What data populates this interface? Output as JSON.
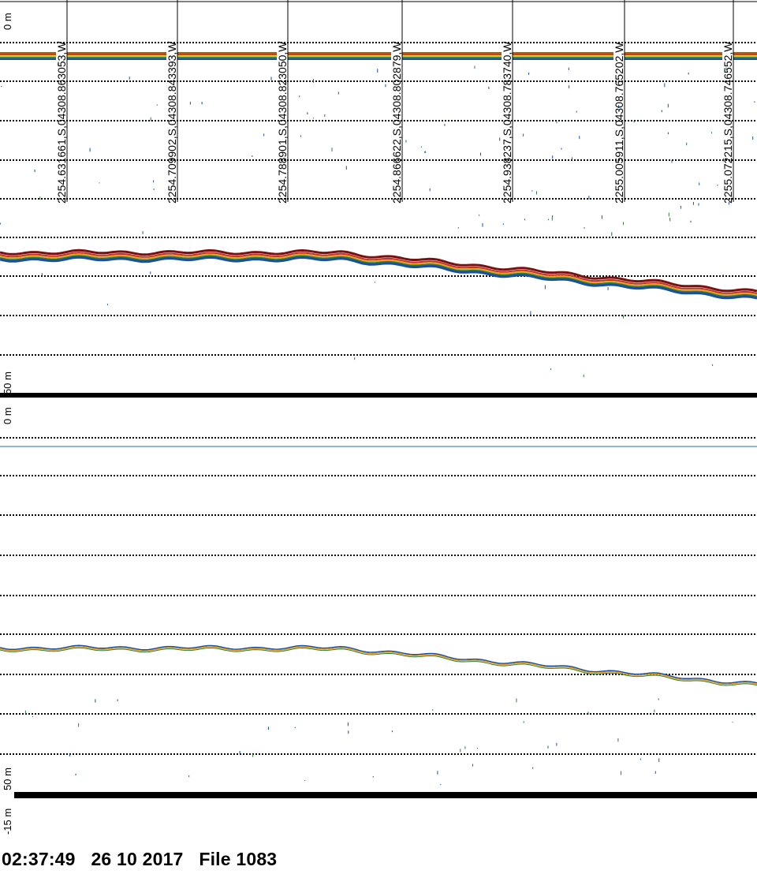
{
  "colors": {
    "background": "#ffffff",
    "gridline": "#000000",
    "echo_strong": "#7a1010",
    "echo_mid": "#e8a020",
    "echo_weak": "#1a4fa0",
    "echo_faint": "#2f7f3a"
  },
  "upper_panel": {
    "depth_top_label": "0 m",
    "depth_bottom_label": "50 m",
    "gps_markers": [
      "2254.631661,S,04308.863053,W",
      "2254.709902,S,04308.843393,W",
      "2254.788901,S,04308.823050,W",
      "2254.866622,S,04308.802879,W",
      "2254.938237,S,04308.783740,W",
      "2255.005911,S,04308.765202,W",
      "2255.072215,S,04308.746552,W"
    ]
  },
  "lower_panel": {
    "depth_top_label": "0 m",
    "depth_bottom_label": "50 m",
    "offset_label": "-15 m"
  },
  "footer": {
    "status": "02:37:49   26 10 2017   File 1083"
  }
}
